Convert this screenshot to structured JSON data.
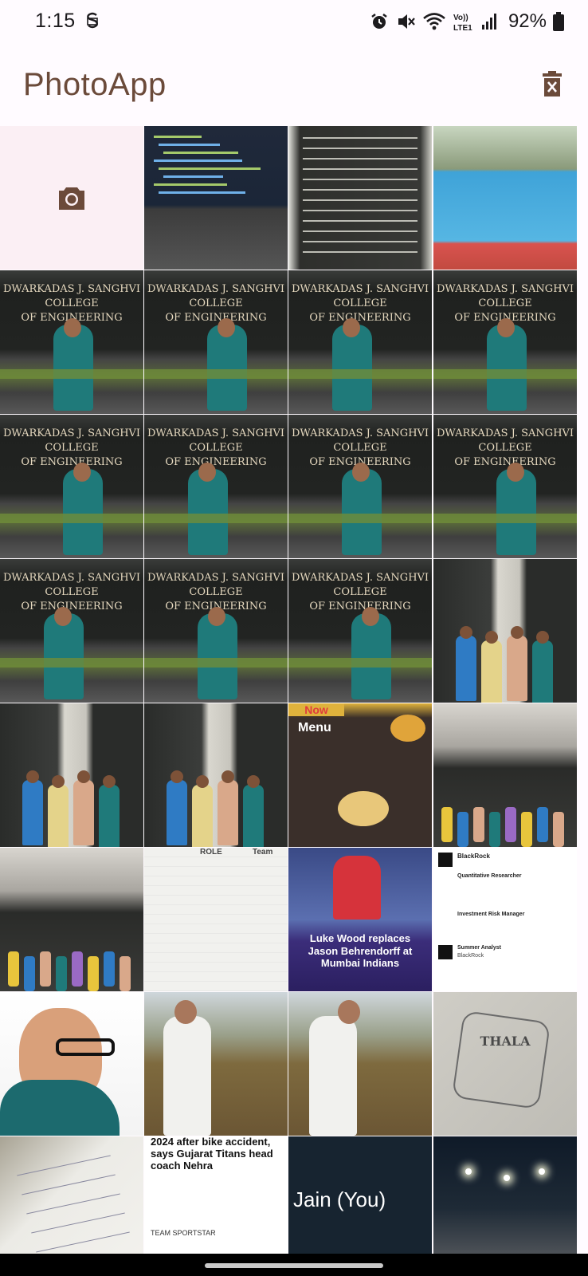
{
  "status_bar": {
    "time": "1:15",
    "battery": "92%"
  },
  "app_bar": {
    "title": "PhotoApp",
    "action_icon": "delete-icon"
  },
  "gallery": {
    "camera_icon": "camera-icon",
    "photos": [
      {
        "id": "photo-laptop-code"
      },
      {
        "id": "photo-printed-schedule"
      },
      {
        "id": "photo-swimming-pool"
      },
      {
        "id": "photo-college-1",
        "sign": [
          "DWARKADAS J. SANGHVI",
          "COLLEGE",
          "OF ENGINEERING"
        ]
      },
      {
        "id": "photo-college-2",
        "sign": [
          "DWARKADAS J. SANGHVI",
          "COLLEGE",
          "OF ENGINEERING"
        ]
      },
      {
        "id": "photo-college-3",
        "sign": [
          "DWARKADAS J. SANGHVI",
          "COLLEGE",
          "OF ENGINEERING"
        ]
      },
      {
        "id": "photo-college-4",
        "sign": [
          "DWARKADAS J. SANGHVI",
          "COLLEGE",
          "OF ENGINEERING"
        ]
      },
      {
        "id": "photo-college-5",
        "sign": [
          "DWARKADAS J. SANGHVI",
          "COLLEGE",
          "OF ENGINEERING"
        ]
      },
      {
        "id": "photo-college-6",
        "sign": [
          "DWARKADAS J. SANGHVI",
          "COLLEGE",
          "OF ENGINEERING"
        ]
      },
      {
        "id": "photo-college-7",
        "sign": [
          "DWARKADAS J. SANGHVI",
          "COLLEGE",
          "OF ENGINEERING"
        ]
      },
      {
        "id": "photo-college-8",
        "sign": [
          "DWARKADAS J. SANGHVI",
          "COLLEGE",
          "OF ENGINEERING"
        ]
      },
      {
        "id": "photo-college-9",
        "sign": [
          "DWARKADAS J. SANGHVI",
          "COLLEGE",
          "OF ENGINEERING"
        ]
      },
      {
        "id": "photo-college-10",
        "sign": [
          "DWARKADAS J. SANGHVI",
          "COLLEGE",
          "OF ENGINEERING"
        ]
      },
      {
        "id": "photo-college-11",
        "sign": [
          "DWARKADAS J. SANGHVI",
          "COLLEGE",
          "OF ENGINEERING"
        ]
      },
      {
        "id": "photo-friends-1"
      },
      {
        "id": "photo-friends-2"
      },
      {
        "id": "photo-friends-3"
      },
      {
        "id": "photo-menu",
        "title": "Menu",
        "badge": "Now"
      },
      {
        "id": "photo-group-1"
      },
      {
        "id": "photo-group-2"
      },
      {
        "id": "photo-team-list",
        "header": "ROLE",
        "col": "Team"
      },
      {
        "id": "photo-news-cricket",
        "headline": "Luke Wood replaces Jason Behrendorff at Mumbai Indians"
      },
      {
        "id": "photo-linkedin",
        "company": "BlackRock",
        "role": "Quantitative Researcher",
        "role2": "Investment Risk Manager",
        "role3": "Summer Analyst"
      },
      {
        "id": "photo-portrait"
      },
      {
        "id": "photo-field-1"
      },
      {
        "id": "photo-field-2"
      },
      {
        "id": "photo-wall-drawing",
        "text": "THALA"
      },
      {
        "id": "photo-notebook"
      },
      {
        "id": "photo-article",
        "headline": "2024 after bike accident, says Gujarat Titans head coach Nehra",
        "source": "TEAM SPORTSTAR"
      },
      {
        "id": "photo-dark-text",
        "text": "Jain (You)"
      },
      {
        "id": "photo-night-street"
      }
    ]
  }
}
